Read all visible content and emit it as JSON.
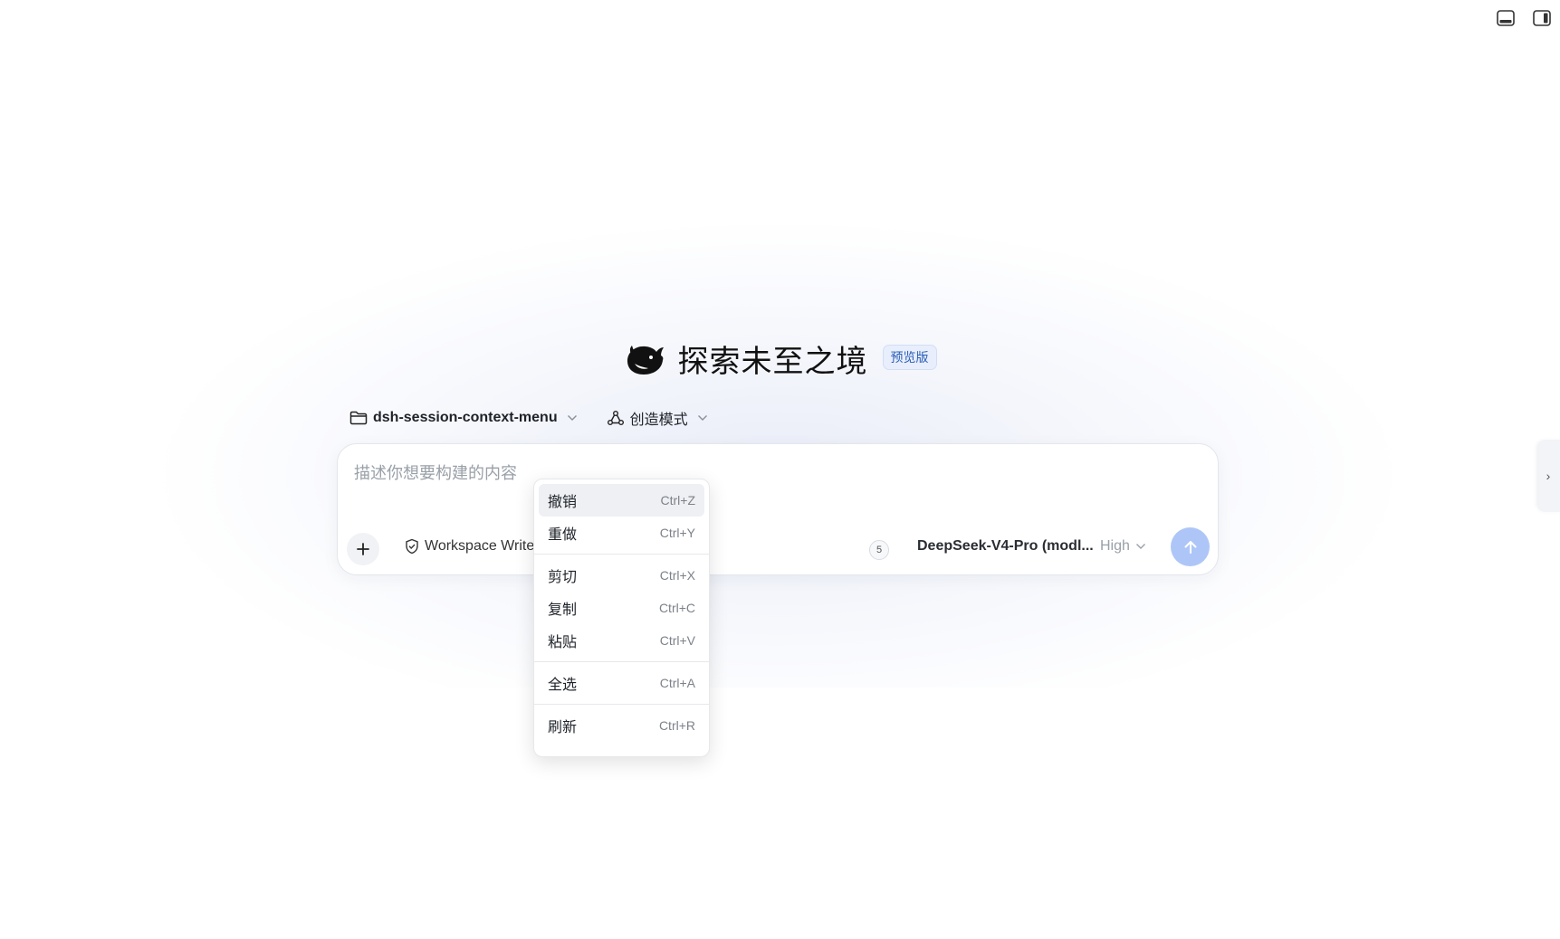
{
  "hero": {
    "title": "探索未至之境",
    "badge": "预览版"
  },
  "context": {
    "folder": "dsh-session-context-menu",
    "mode": "创造模式"
  },
  "composer": {
    "placeholder": "描述你想要构建的内容",
    "permission_label": "Workspace Write",
    "count": "5",
    "model": "DeepSeek-V4-Pro (modl...",
    "effort": "High"
  },
  "context_menu": {
    "items": [
      {
        "label": "撤销",
        "shortcut": "Ctrl+Z"
      },
      {
        "label": "重做",
        "shortcut": "Ctrl+Y"
      },
      {
        "label": "剪切",
        "shortcut": "Ctrl+X"
      },
      {
        "label": "复制",
        "shortcut": "Ctrl+C"
      },
      {
        "label": "粘贴",
        "shortcut": "Ctrl+V"
      },
      {
        "label": "全选",
        "shortcut": "Ctrl+A"
      },
      {
        "label": "刷新",
        "shortcut": "Ctrl+R"
      }
    ]
  },
  "edge_tab": {
    "glyph": "›"
  },
  "colors": {
    "accent": "#aec6f7",
    "badge_bg": "#e8eefb",
    "badge_text": "#2b5fb8"
  }
}
